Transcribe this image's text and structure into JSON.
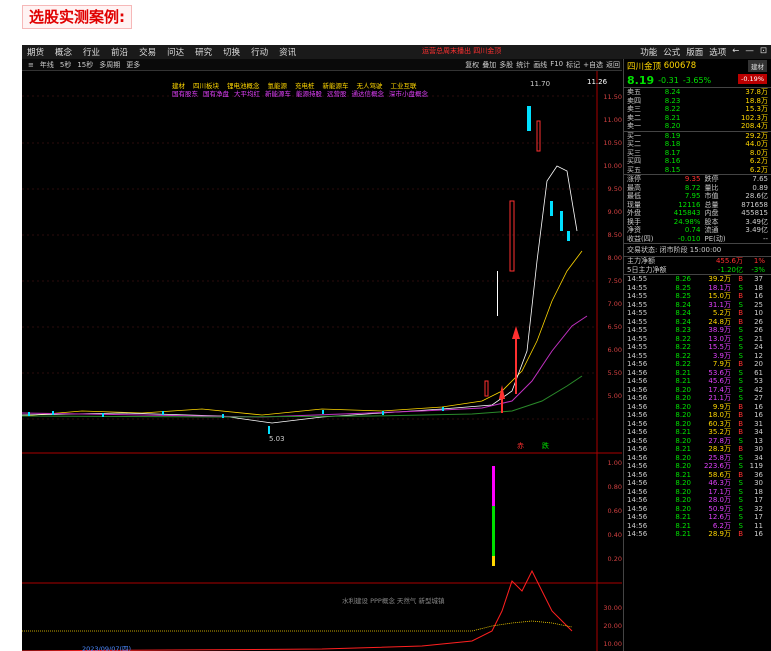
{
  "heading": "选股实测案例:",
  "menu": [
    "期货",
    "概念",
    "行业",
    "前沿",
    "交易",
    "问达",
    "研究",
    "切换",
    "行动",
    "资讯"
  ],
  "alert": "运营总周末播出 四川金顶",
  "right_menu": [
    "功能",
    "公式",
    "版面",
    "选项",
    "←",
    "—",
    "⊡"
  ],
  "toolbar_left": [
    "≡",
    "年线",
    "5秒",
    "15秒",
    "多周期",
    "更多"
  ],
  "toolbar_right": [
    "复权",
    "叠加",
    "多股",
    "统计",
    "画线",
    "F10",
    "标记",
    "+自选",
    "返回"
  ],
  "indicators_top": [
    "建材",
    "四川板块",
    "锂电池概念",
    "氢能源",
    "充电桩",
    "新能源车",
    "无人驾驶",
    "工业互联"
  ],
  "indicators_sub": [
    "国有股东",
    "国有净盘",
    "大平均红",
    "新能源车",
    "能源持股",
    "远营股",
    "通达信概念",
    "深市小盘概念"
  ],
  "price_axis": [
    "11.50",
    "11.00",
    "10.50",
    "10.00",
    "9.50",
    "9.00",
    "8.50",
    "8.00",
    "7.50",
    "7.00",
    "6.50",
    "6.00",
    "5.50",
    "5.00"
  ],
  "price_tag": "11.26",
  "high_label": "11.70",
  "low_label": "5.03",
  "sub_axis": [
    "1.00",
    "0.80",
    "0.60",
    "0.40",
    "0.20"
  ],
  "bottom_axis": [
    "30.00",
    "20.00",
    "10.00"
  ],
  "bottom_caption": "水利建设 PPP概念 天然气 新型城镇",
  "date_label": "2023/09/07(四)",
  "buy_sell": [
    "赤",
    "跌"
  ],
  "stock": {
    "name": "四川金顶",
    "code": "600678",
    "tag": "建材",
    "price": "8.19",
    "change": "-0.31",
    "pct": "-3.65%",
    "pct_tag": "-0.19%"
  },
  "asks": [
    [
      "卖五",
      "8.24",
      "37.8万"
    ],
    [
      "卖四",
      "8.23",
      "18.8万"
    ],
    [
      "卖三",
      "8.22",
      "15.3万"
    ],
    [
      "卖二",
      "8.21",
      "102.3万"
    ],
    [
      "卖一",
      "8.20",
      "208.4万"
    ]
  ],
  "bids": [
    [
      "买一",
      "8.19",
      "29.2万"
    ],
    [
      "买二",
      "8.18",
      "44.0万"
    ],
    [
      "买三",
      "8.17",
      "8.0万"
    ],
    [
      "买四",
      "8.16",
      "6.2万"
    ],
    [
      "买五",
      "8.15",
      "6.2万"
    ]
  ],
  "stats": [
    [
      "涨停",
      "9.35",
      "跌停",
      "7.65"
    ],
    [
      "最高",
      "8.72",
      "量比",
      "0.89"
    ],
    [
      "最低",
      "7.95",
      "市值",
      "28.6亿"
    ],
    [
      "现量",
      "12116",
      "总量",
      "871658"
    ],
    [
      "外盘",
      "415843",
      "内盘",
      "455815"
    ],
    [
      "换手",
      "24.98%",
      "股本",
      "3.49亿"
    ],
    [
      "净资",
      "0.74",
      "流通",
      "3.49亿"
    ],
    [
      "收益(四)",
      "-0.010",
      "PE(动)",
      "--"
    ]
  ],
  "status": "交易状态: 闭市阶段 15:00:00",
  "flow": [
    [
      "主力净额",
      "455.6万",
      "1%"
    ],
    [
      "5日主力净额",
      "-1.20亿",
      "-3%"
    ]
  ],
  "ticks": [
    [
      "14:55",
      "8.26",
      "39.2万",
      "B",
      "37"
    ],
    [
      "14:55",
      "8.25",
      "18.1万",
      "S",
      "18"
    ],
    [
      "14:55",
      "8.25",
      "15.0万",
      "B",
      "16"
    ],
    [
      "14:55",
      "8.24",
      "31.1万",
      "S",
      "25"
    ],
    [
      "14:55",
      "8.24",
      "5.2万",
      "B",
      "10"
    ],
    [
      "14:55",
      "8.24",
      "24.8万",
      "B",
      "26"
    ],
    [
      "14:55",
      "8.23",
      "38.9万",
      "S",
      "26"
    ],
    [
      "14:55",
      "8.22",
      "13.0万",
      "S",
      "21"
    ],
    [
      "14:55",
      "8.22",
      "15.5万",
      "S",
      "24"
    ],
    [
      "14:55",
      "8.22",
      "3.9万",
      "S",
      "12"
    ],
    [
      "14:56",
      "8.22",
      "7.9万",
      "B",
      "20"
    ],
    [
      "14:56",
      "8.21",
      "53.6万",
      "S",
      "61"
    ],
    [
      "14:56",
      "8.21",
      "45.6万",
      "S",
      "53"
    ],
    [
      "14:56",
      "8.20",
      "17.4万",
      "S",
      "42"
    ],
    [
      "14:56",
      "8.20",
      "21.1万",
      "S",
      "27"
    ],
    [
      "14:56",
      "8.20",
      "9.9万",
      "B",
      "16"
    ],
    [
      "14:56",
      "8.20",
      "18.0万",
      "B",
      "16"
    ],
    [
      "14:56",
      "8.20",
      "60.3万",
      "B",
      "31"
    ],
    [
      "14:56",
      "8.21",
      "35.2万",
      "B",
      "34"
    ],
    [
      "14:56",
      "8.20",
      "27.8万",
      "S",
      "13"
    ],
    [
      "14:56",
      "8.21",
      "28.3万",
      "B",
      "30"
    ],
    [
      "14:56",
      "8.20",
      "25.8万",
      "S",
      "34"
    ],
    [
      "14:56",
      "8.20",
      "223.6万",
      "S",
      "119"
    ],
    [
      "14:56",
      "8.21",
      "58.6万",
      "B",
      "36"
    ],
    [
      "14:56",
      "8.20",
      "46.3万",
      "S",
      "30"
    ],
    [
      "14:56",
      "8.20",
      "17.1万",
      "S",
      "18"
    ],
    [
      "14:56",
      "8.20",
      "28.0万",
      "S",
      "17"
    ],
    [
      "14:56",
      "8.20",
      "50.9万",
      "S",
      "32"
    ],
    [
      "14:56",
      "8.21",
      "12.6万",
      "S",
      "17"
    ],
    [
      "14:56",
      "8.21",
      "6.2万",
      "S",
      "11"
    ],
    [
      "14:56",
      "8.21",
      "28.9万",
      "B",
      "16"
    ]
  ]
}
